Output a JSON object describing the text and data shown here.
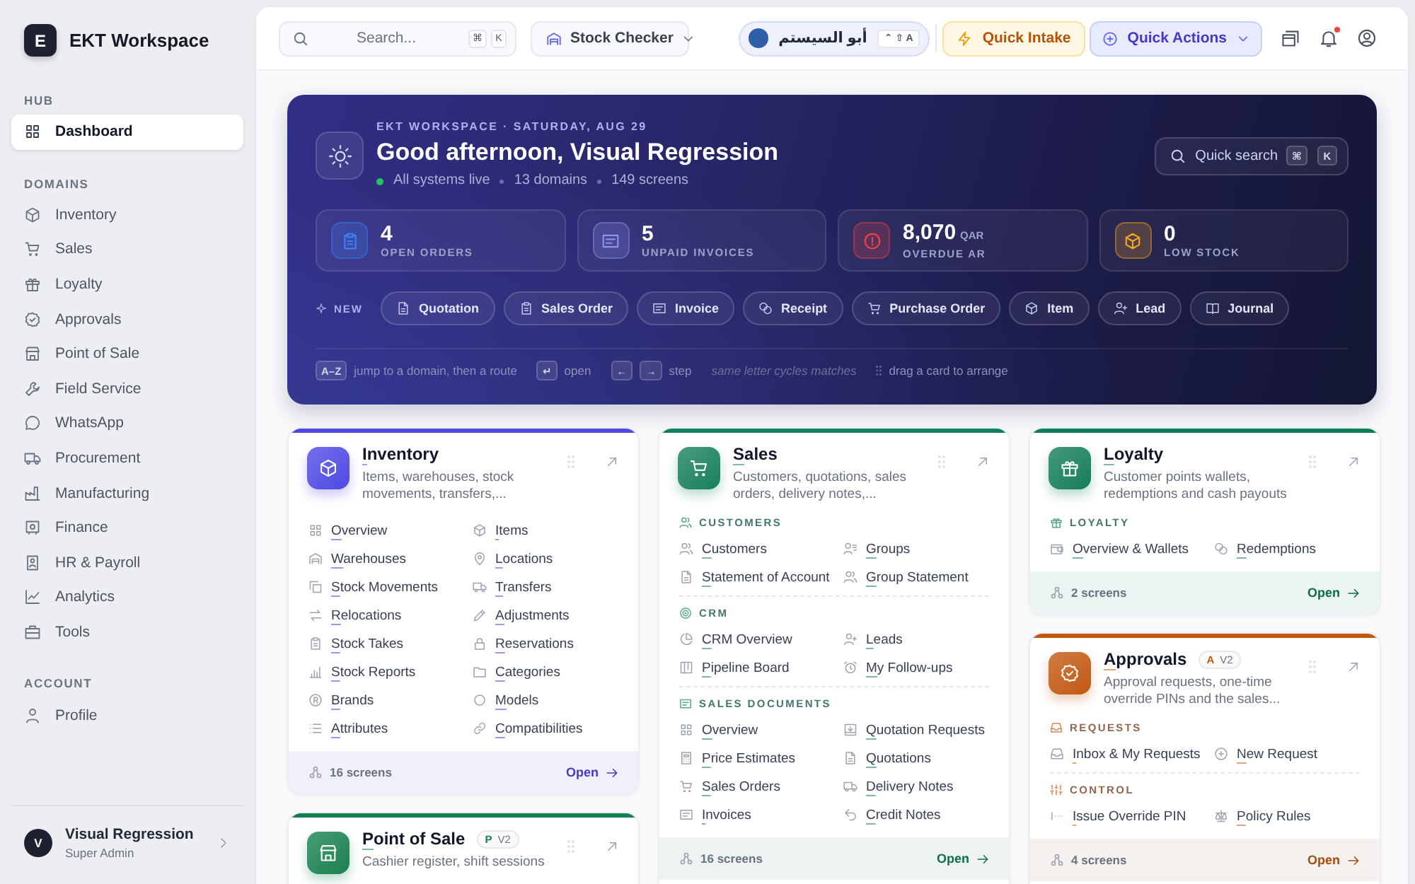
{
  "sidebar": {
    "brand": {
      "letter": "E",
      "name": "EKT Workspace"
    },
    "sections": [
      {
        "title": "HUB",
        "items": [
          {
            "label": "Dashboard",
            "selected": true
          }
        ]
      },
      {
        "title": "DOMAINS",
        "items": [
          {
            "label": "Inventory",
            "selected": false
          },
          {
            "label": "Sales",
            "selected": false
          },
          {
            "label": "Loyalty",
            "selected": false
          },
          {
            "label": "Approvals",
            "selected": false
          },
          {
            "label": "Point of Sale",
            "selected": false
          },
          {
            "label": "Field Service",
            "selected": false
          },
          {
            "label": "WhatsApp",
            "selected": false
          },
          {
            "label": "Procurement",
            "selected": false
          },
          {
            "label": "Manufacturing",
            "selected": false
          },
          {
            "label": "Finance",
            "selected": false
          },
          {
            "label": "HR & Payroll",
            "selected": false
          },
          {
            "label": "Analytics",
            "selected": false
          },
          {
            "label": "Tools",
            "selected": false
          }
        ]
      },
      {
        "title": "ACCOUNT",
        "items": [
          {
            "label": "Profile",
            "selected": false
          }
        ]
      }
    ],
    "user": {
      "initial": "V",
      "name": "Visual Regression",
      "role": "Super Admin"
    }
  },
  "topbar": {
    "search": {
      "placeholder": "Search...",
      "keys": [
        "⌘",
        "K"
      ]
    },
    "app_switcher": {
      "label": "Stock Checker"
    },
    "company": {
      "name": "أبو السيستم",
      "shortcut": "⌃ ⇧ A"
    },
    "quick_intake": {
      "label": "Quick Intake"
    },
    "quick_actions": {
      "label": "Quick Actions"
    },
    "notifications": {
      "unread": true
    }
  },
  "hero": {
    "eyebrow": "EKT WORKSPACE · SATURDAY, AUG 29",
    "title": "Good afternoon, Visual Regression",
    "status": {
      "label": "All systems live",
      "live": true
    },
    "meta": [
      "13 domains",
      "149 screens"
    ],
    "quick_search": {
      "label": "Quick search",
      "keys": [
        "⌘",
        "K"
      ]
    },
    "stats": [
      {
        "value": "4",
        "label": "OPEN ORDERS",
        "color": "#3b82f6"
      },
      {
        "value": "5",
        "label": "UNPAID INVOICES",
        "color": "#8b93f0"
      },
      {
        "value": "8,070",
        "unit": "QAR",
        "label": "OVERDUE AR",
        "color": "#ef4444"
      },
      {
        "value": "0",
        "label": "LOW STOCK",
        "color": "#f5a524"
      }
    ],
    "new": {
      "label": "NEW",
      "actions": [
        "Quotation",
        "Sales Order",
        "Invoice",
        "Receipt",
        "Purchase Order",
        "Item",
        "Lead",
        "Journal"
      ]
    },
    "hints": [
      {
        "kind": "keys",
        "keys": [
          "A–Z"
        ],
        "text": "jump to a domain, then a route"
      },
      {
        "kind": "keys",
        "keys": [
          "↵"
        ],
        "text": "open"
      },
      {
        "kind": "keys",
        "keys": [
          "←",
          "→"
        ],
        "text": "step"
      },
      {
        "kind": "note",
        "text": "same letter cycles matches"
      },
      {
        "kind": "drag",
        "text": "drag a card to arrange"
      }
    ]
  },
  "card_columns": [
    [
      {
        "title": "Inventory",
        "description": "Items, warehouses, stock movements, transfers,...",
        "color": "#4f46e5",
        "sections": [
          {
            "links": [
              "Overview",
              "Items",
              "Warehouses",
              "Locations",
              "Stock Movements",
              "Transfers",
              "Relocations",
              "Adjustments",
              "Stock Takes",
              "Reservations",
              "Stock Reports",
              "Categories",
              "Brands",
              "Models",
              "Attributes",
              "Compatibilities"
            ]
          }
        ],
        "footer": {
          "screens": "16 screens",
          "open": "Open"
        }
      },
      {
        "title": "Point of Sale",
        "badge": {
          "letter": "P",
          "version": "V2"
        },
        "description": "Cashier register, shift sessions",
        "color": "#15804f"
      }
    ],
    [
      {
        "title": "Sales",
        "description": "Customers, quotations, sales orders, delivery notes,...",
        "color": "#12805a",
        "sections": [
          {
            "title": "CUSTOMERS",
            "links": [
              "Customers",
              "Groups",
              "Statement of Account",
              "Group Statement"
            ]
          },
          {
            "title": "CRM",
            "links": [
              "CRM Overview",
              "Leads",
              "Pipeline Board",
              "My Follow-ups"
            ]
          },
          {
            "title": "SALES DOCUMENTS",
            "links": [
              "Overview",
              "Quotation Requests",
              "Price Estimates",
              "Quotations",
              "Sales Orders",
              "Delivery Notes",
              "Invoices",
              "Credit Notes"
            ]
          }
        ],
        "footer": {
          "screens": "16 screens",
          "open": "Open"
        }
      }
    ],
    [
      {
        "title": "Loyalty",
        "description": "Customer points wallets, redemptions and cash payouts",
        "color": "#0f7d57",
        "sections": [
          {
            "title": "LOYALTY",
            "links": [
              "Overview & Wallets",
              "Redemptions"
            ]
          }
        ],
        "footer": {
          "screens": "2 screens",
          "open": "Open"
        }
      },
      {
        "title": "Approvals",
        "badge": {
          "letter": "A",
          "version": "V2"
        },
        "description": "Approval requests, one-time override PINs and the sales...",
        "color": "#c2570c",
        "sections": [
          {
            "title": "REQUESTS",
            "links": [
              "Inbox & My Requests",
              "New Request"
            ]
          },
          {
            "title": "CONTROL",
            "links": [
              "Issue Override PIN",
              "Policy Rules"
            ]
          }
        ],
        "footer": {
          "screens": "4 screens",
          "open": "Open"
        }
      }
    ]
  ]
}
